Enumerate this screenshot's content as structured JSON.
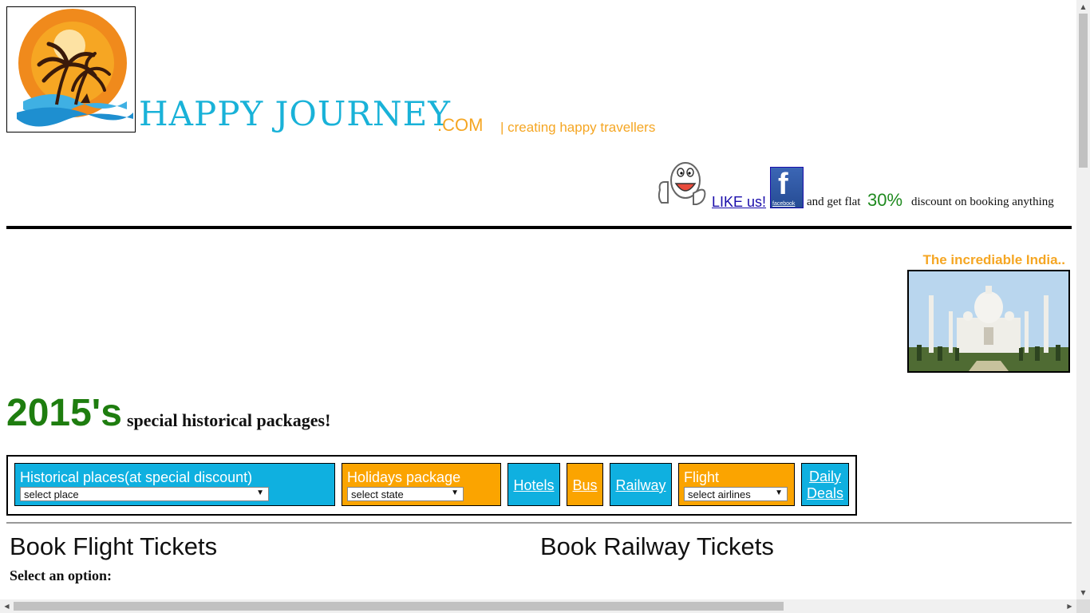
{
  "header": {
    "brand": "HAPPY JOURNEY",
    "domain": ".COM",
    "tagline": "| creating happy travellers"
  },
  "promo": {
    "like_link": "LIKE us!",
    "facebook_icon_label": "facebook",
    "text_before": "and get flat",
    "discount": "30%",
    "text_after": "discount on booking anything"
  },
  "feature": {
    "title": "The incrediable India..",
    "image": "taj-mahal-photo"
  },
  "banner": {
    "year": "2015's",
    "subtitle": "special historical packages!"
  },
  "nav": {
    "historical": {
      "label": "Historical places(at special discount)",
      "select_value": "select place"
    },
    "holidays": {
      "label": "Holidays package",
      "select_value": "select state"
    },
    "hotels": "Hotels",
    "bus": "Bus",
    "railway": "Railway",
    "flight": {
      "label": "Flight",
      "select_value": "select airlines"
    },
    "daily_deals_line1": "Daily",
    "daily_deals_line2": "Deals"
  },
  "sections": {
    "flight_heading": "Book Flight Tickets",
    "rail_heading": "Book Railway Tickets",
    "select_option": "Select an option:"
  },
  "colors": {
    "brand_blue": "#19b2d8",
    "accent_orange": "#f5a623",
    "nav_blue": "#0fb0e0",
    "nav_orange": "#fba400",
    "green": "#1e7d0f"
  }
}
